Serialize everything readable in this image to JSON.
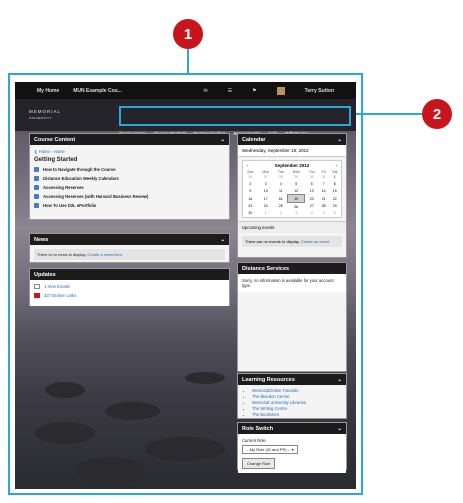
{
  "callouts": {
    "one": "1",
    "two": "2"
  },
  "topbar": {
    "my_home": "My Home",
    "course_selector": "MUN Example Cou...",
    "user_name": "Terry Sutton"
  },
  "header": {
    "logo_line1": "MEMORIAL",
    "logo_line2": "UNIVERSITY"
  },
  "nav": {
    "items": [
      "Course Home",
      "Course Content",
      "Communication",
      "Assessments",
      "Help",
      "Edit Course"
    ]
  },
  "course_content": {
    "title": "Course Content",
    "breadcrumb_home1": "Home",
    "breadcrumb_home2": "Home",
    "section": "Getting Started",
    "items": [
      "How to Navigate through the Course",
      "Distance Education Weekly Calendars",
      "Accessing Reserves",
      "Accessing Reserves (with Harvard Business Review)",
      "How To Use D2L ePortfolio"
    ]
  },
  "news": {
    "title": "News",
    "message": "There is no news to display.",
    "create_link": "Create a news item."
  },
  "updates": {
    "title": "Updates",
    "new_emails": "1 New Emails",
    "broken_links": "327 Broken Links"
  },
  "calendar": {
    "title": "Calendar",
    "current_date": "Wednesday, September 19, 2012",
    "month_label": "September 2012",
    "weekdays": [
      "Sun",
      "Mon",
      "Tue",
      "Wed",
      "Thu",
      "Fri",
      "Sat"
    ],
    "weeks": [
      [
        "26",
        "27",
        "28",
        "29",
        "30",
        "31",
        "1"
      ],
      [
        "2",
        "3",
        "4",
        "5",
        "6",
        "7",
        "8"
      ],
      [
        "9",
        "10",
        "11",
        "12",
        "13",
        "14",
        "15"
      ],
      [
        "16",
        "17",
        "18",
        "19",
        "20",
        "21",
        "22"
      ],
      [
        "23",
        "24",
        "25",
        "26",
        "27",
        "28",
        "29"
      ],
      [
        "30",
        "1",
        "2",
        "3",
        "4",
        "5",
        "6"
      ]
    ],
    "upcoming_label": "Upcoming events",
    "no_events": "There are no events to display.",
    "create_event": "Create an event."
  },
  "distance_services": {
    "title": "Distance Services",
    "message": "Sorry, no information is available for your account type."
  },
  "learning_resources": {
    "title": "Learning Resources",
    "links": [
      "MemorialOnline Tutorials",
      "The Blundon Centre",
      "Memorial University Libraries",
      "The Writing Centre",
      "The Bookstore"
    ]
  },
  "role_switch": {
    "title": "Role Switch",
    "label": "Current Role",
    "selected": "-- My Role (ID and PR) --",
    "button": "Change Role"
  }
}
